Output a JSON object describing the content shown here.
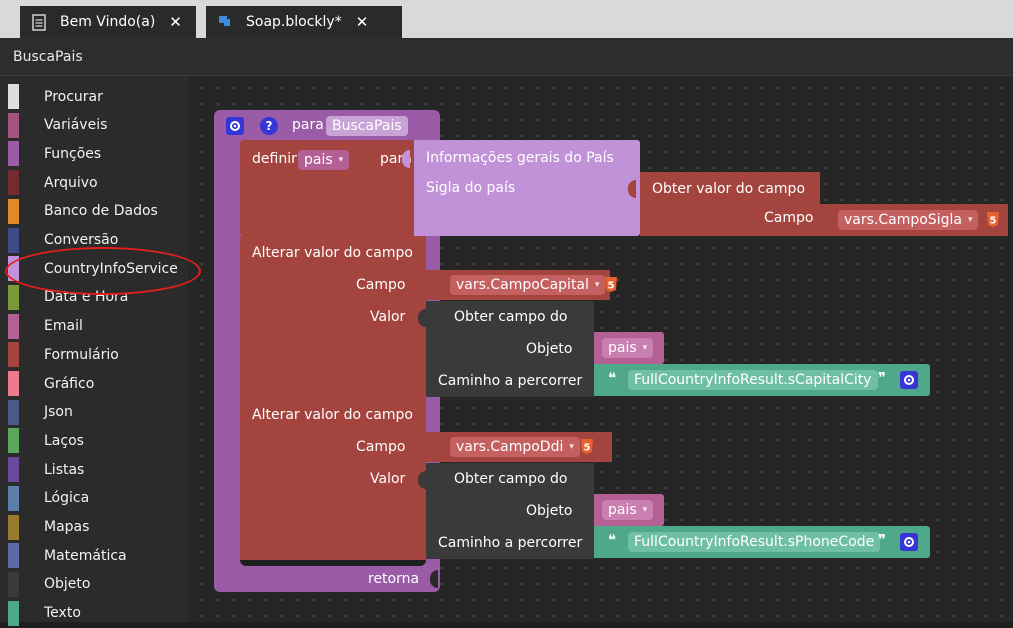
{
  "tabs": [
    {
      "label": "Bem Vindo(a)",
      "icon": "document-icon",
      "close": "✕"
    },
    {
      "label": "Soap.blockly*",
      "icon": "puzzle-icon",
      "close": "✕"
    }
  ],
  "breadcrumb": "BuscaPais",
  "categories": [
    {
      "label": "Procurar",
      "color": "#dddddd"
    },
    {
      "label": "Variáveis",
      "color": "#a3547e"
    },
    {
      "label": "Funções",
      "color": "#9a5ca7"
    },
    {
      "label": "Arquivo",
      "color": "#742b2f"
    },
    {
      "label": "Banco de Dados",
      "color": "#e08a2e"
    },
    {
      "label": "Conversão",
      "color": "#3e4b86"
    },
    {
      "label": "CountryInfoService",
      "color": "#c292d8"
    },
    {
      "label": "Data e Hora",
      "color": "#7a9a3a"
    },
    {
      "label": "Email",
      "color": "#b56095"
    },
    {
      "label": "Formulário",
      "color": "#a4443e"
    },
    {
      "label": "Gráfico",
      "color": "#ee7a8f"
    },
    {
      "label": "Json",
      "color": "#495c89"
    },
    {
      "label": "Laços",
      "color": "#5aa65a"
    },
    {
      "label": "Listas",
      "color": "#6a4a9c"
    },
    {
      "label": "Lógica",
      "color": "#5a7fa8"
    },
    {
      "label": "Mapas",
      "color": "#9a7b2e"
    },
    {
      "label": "Matemática",
      "color": "#5a6aa8"
    },
    {
      "label": "Objeto",
      "color": "#3a3a3a"
    },
    {
      "label": "Texto",
      "color": "#4fa88a"
    }
  ],
  "blocks": {
    "proc_prefix": "para",
    "proc_name": "BuscaPais",
    "help": "?",
    "definir": "definir",
    "var_pais": "pais",
    "para": "para",
    "info_title": "Informações gerais do País",
    "sigla": "Sigla do país",
    "obter_valor": "Obter valor do campo",
    "campo": "Campo",
    "campo_sigla": "vars.CampoSigla",
    "alterar": "Alterar valor do campo",
    "campo_capital": "vars.CampoCapital",
    "valor": "Valor",
    "obter_campo_do": "Obter campo do",
    "objeto": "Objeto",
    "caminho": "Caminho a percorrer",
    "open_quote": "❝",
    "close_quote": "❞",
    "path_capital": "FullCountryInfoResult.sCapitalCity",
    "campo_ddi": "vars.CampoDdi",
    "path_phone": "FullCountryInfoResult.sPhoneCode",
    "retorna": "retorna",
    "dropdown_arrow": "▾"
  },
  "annotation": {
    "color": "#e0201e",
    "target": "CountryInfoService"
  }
}
